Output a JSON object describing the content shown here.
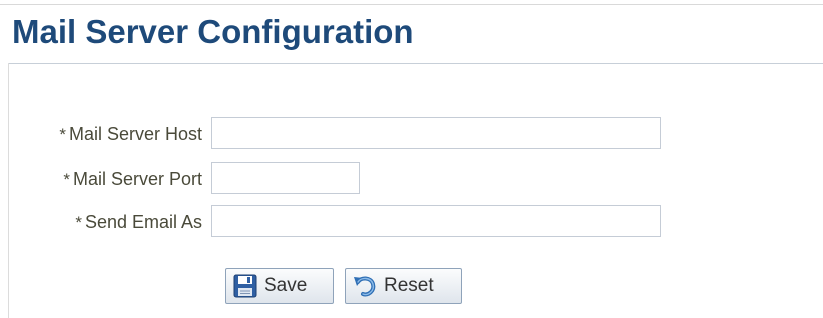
{
  "page": {
    "title": "Mail Server Configuration"
  },
  "form": {
    "required_marker": "*",
    "fields": [
      {
        "label": "Mail Server Host",
        "value": "",
        "placeholder": ""
      },
      {
        "label": "Mail Server Port",
        "value": "",
        "placeholder": ""
      },
      {
        "label": "Send Email As",
        "value": "",
        "placeholder": ""
      }
    ]
  },
  "actions": {
    "save_label": "Save",
    "save_icon": "floppy-disk-icon",
    "reset_label": "Reset",
    "reset_icon": "undo-arrow-icon"
  },
  "colors": {
    "title": "#1e4a7a",
    "label": "#4a4a3a",
    "field_border": "#c5ccd6",
    "button_border": "#8fa3ba"
  }
}
